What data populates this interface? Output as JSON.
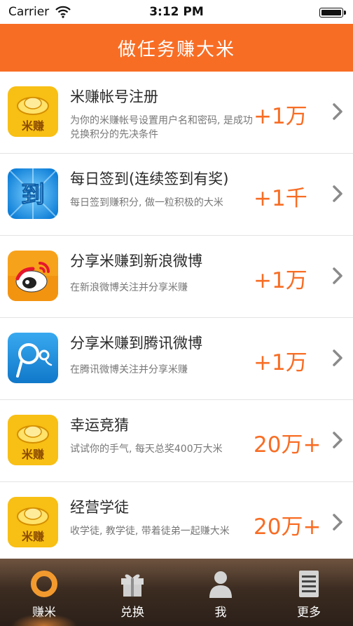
{
  "status_bar": {
    "carrier": "Carrier",
    "time": "3:12 PM"
  },
  "header": {
    "title": "做任务赚大米"
  },
  "tasks": [
    {
      "name": "米赚帐号注册",
      "desc": "为你的米赚帐号设置用户名和密码, 是成功兑换积分的先决条件",
      "reward": "+1万",
      "icon": "mizhuan-ingot-icon"
    },
    {
      "name": "每日签到(连续签到有奖)",
      "desc": "每日签到赚积分, 做一粒积极的大米",
      "reward": "+1千",
      "icon": "checkin-icon"
    },
    {
      "name": "分享米赚到新浪微博",
      "desc": "在新浪微博关注并分享米赚",
      "reward": "+1万",
      "icon": "sina-weibo-icon"
    },
    {
      "name": "分享米赚到腾讯微博",
      "desc": "在腾讯微博关注并分享米赚",
      "reward": "+1万",
      "icon": "tencent-weibo-icon"
    },
    {
      "name": "幸运竞猜",
      "desc": "试试你的手气, 每天总奖400万大米",
      "reward": "20万+",
      "icon": "mizhuan-ingot-icon"
    },
    {
      "name": "经营学徒",
      "desc": "收学徒, 教学徒, 带着徒弟一起赚大米",
      "reward": "20万+",
      "icon": "mizhuan-ingot-icon"
    }
  ],
  "ingot_label": "米赚",
  "checkin_glyph": "到",
  "tabs": [
    {
      "label": "赚米",
      "icon": "ring-icon",
      "active": true
    },
    {
      "label": "兑换",
      "icon": "gift-icon",
      "active": false
    },
    {
      "label": "我",
      "icon": "user-icon",
      "active": false
    },
    {
      "label": "更多",
      "icon": "list-icon",
      "active": false
    }
  ],
  "colors": {
    "accent": "#f86d24",
    "tabbar": "#3c2c21",
    "active_tab": "#f39a2e"
  }
}
